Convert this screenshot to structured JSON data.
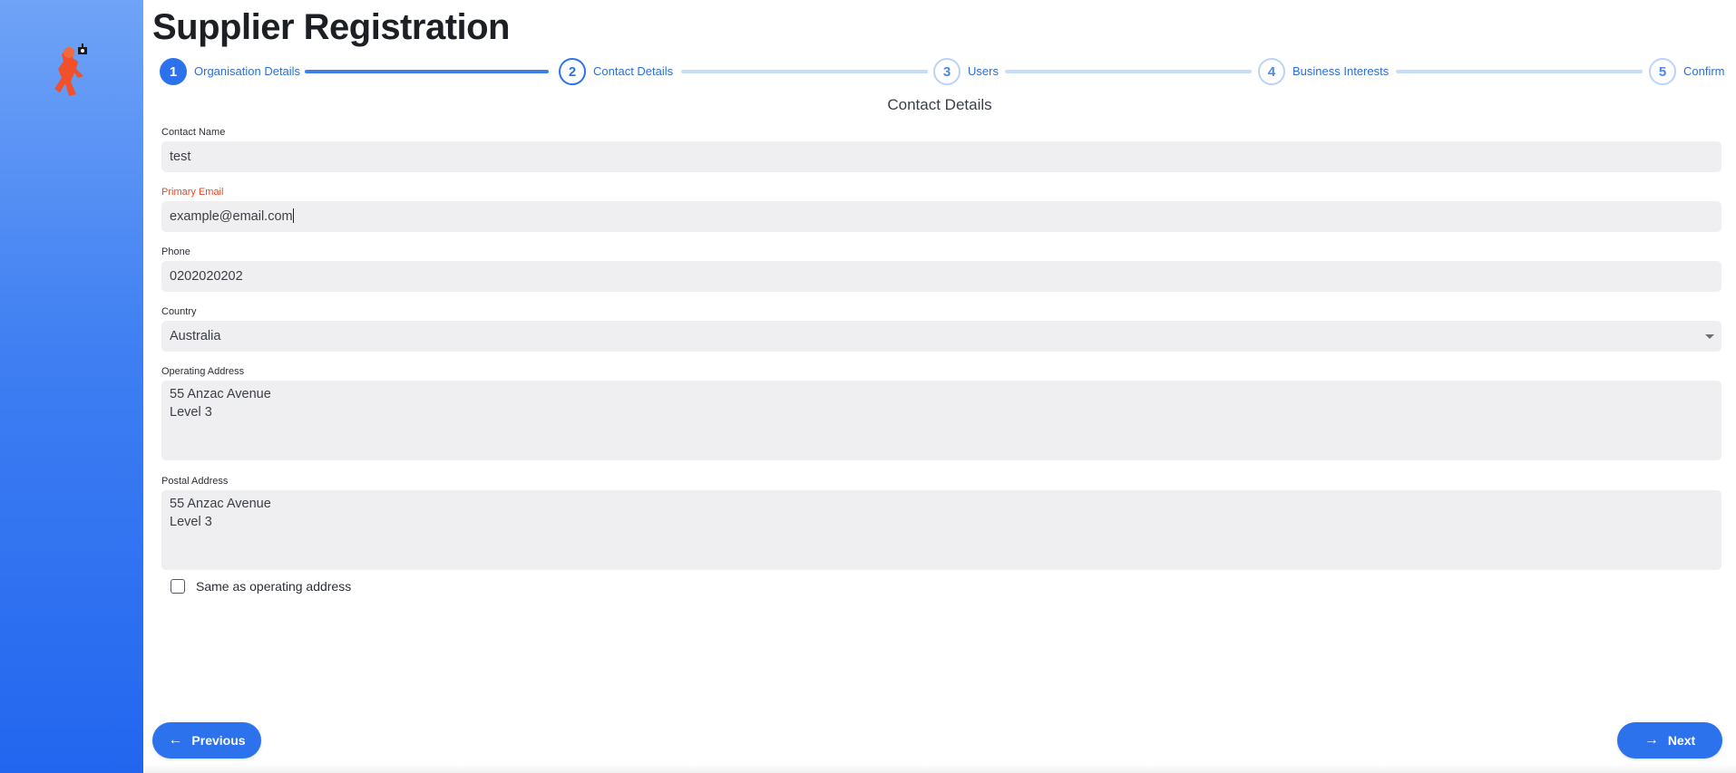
{
  "page": {
    "title": "Supplier Registration",
    "section_title": "Contact Details"
  },
  "stepper": {
    "steps": [
      {
        "number": "1",
        "label": "Organisation Details",
        "state": "done"
      },
      {
        "number": "2",
        "label": "Contact Details",
        "state": "active"
      },
      {
        "number": "3",
        "label": "Users",
        "state": "pending"
      },
      {
        "number": "4",
        "label": "Business Interests",
        "state": "pending"
      },
      {
        "number": "5",
        "label": "Confirm",
        "state": "pending"
      }
    ]
  },
  "form": {
    "contact_name": {
      "label": "Contact Name",
      "value": "test"
    },
    "primary_email": {
      "label": "Primary Email",
      "value": "example@email.com"
    },
    "phone": {
      "label": "Phone",
      "value": "0202020202"
    },
    "country": {
      "label": "Country",
      "value": "Australia"
    },
    "operating_address": {
      "label": "Operating Address",
      "value": "55 Anzac Avenue\nLevel 3"
    },
    "postal_address": {
      "label": "Postal Address",
      "value": "55 Anzac Avenue\nLevel 3"
    },
    "same_as_operating": {
      "label": "Same as operating address",
      "checked": false
    }
  },
  "buttons": {
    "previous": "Previous",
    "next": "Next"
  },
  "icons": {
    "previous": "arrow-left-icon",
    "next": "arrow-right-icon",
    "logo": "brand-mascot-logo"
  },
  "colors": {
    "accent": "#2c72ec",
    "error": "#e24b2b",
    "sidebar_top": "#6fa3f7",
    "sidebar_bottom": "#2266ef"
  }
}
